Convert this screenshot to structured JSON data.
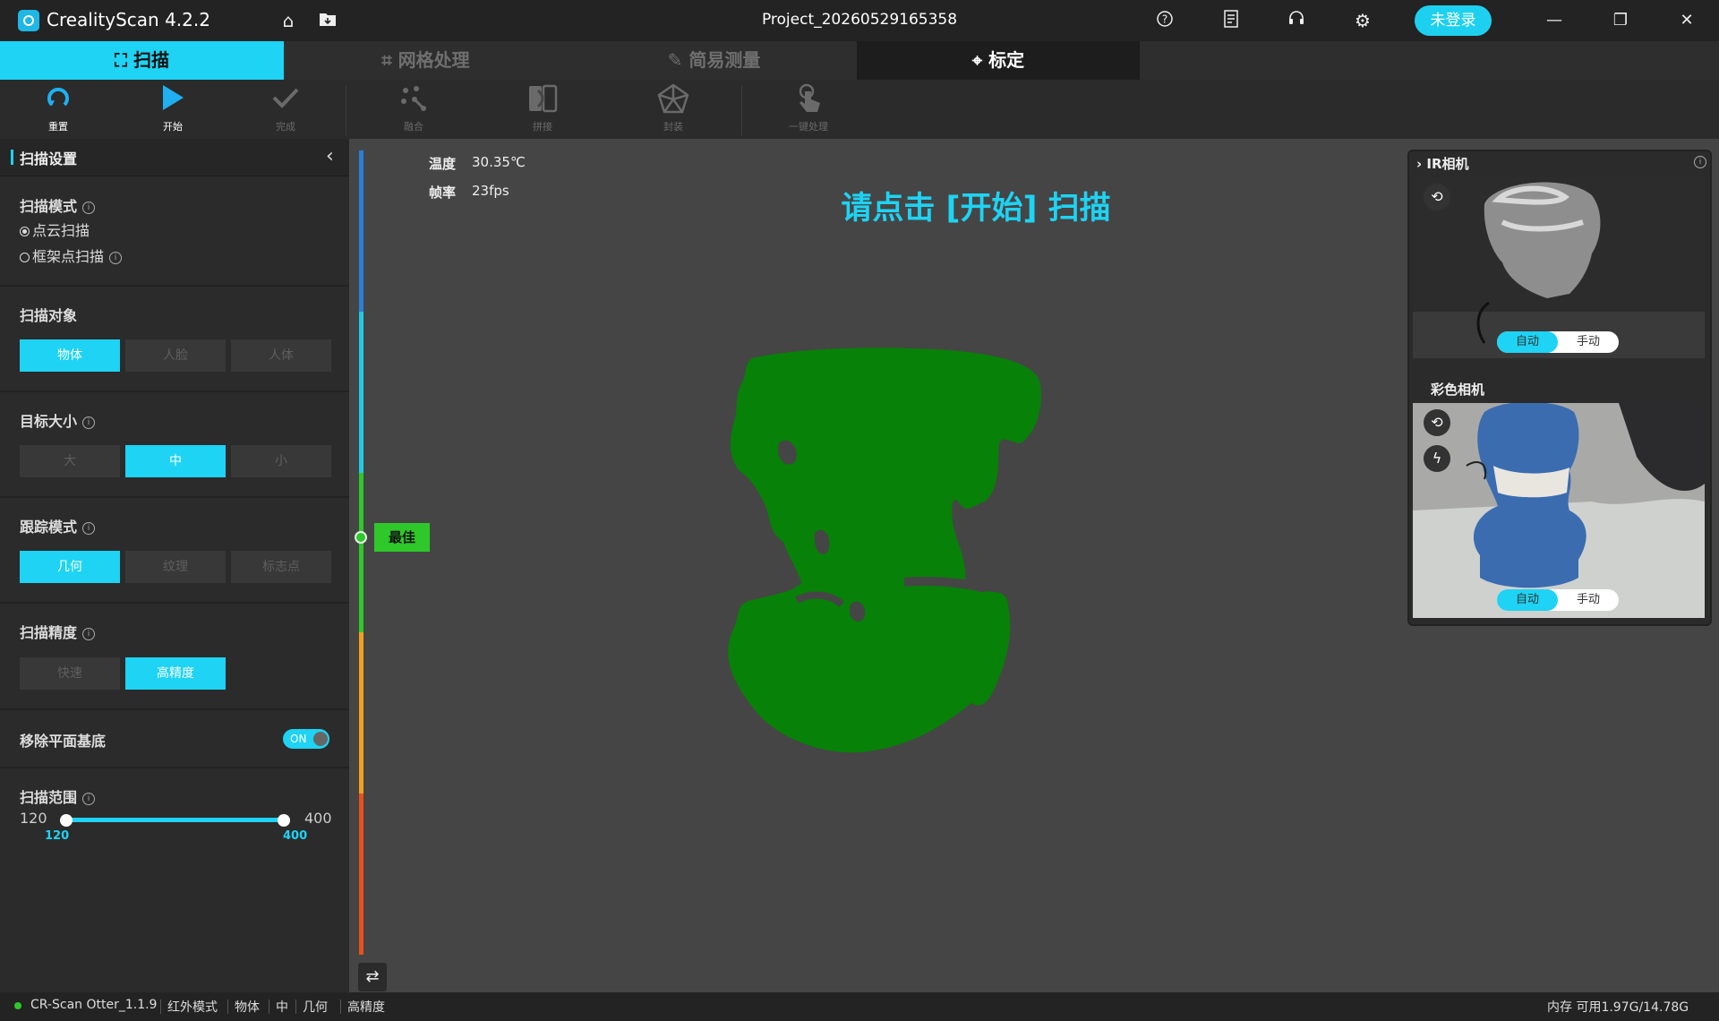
{
  "titlebar": {
    "app_name": "CrealityScan 4.2.2",
    "project": "Project_20260529165358",
    "login": "未登录",
    "icons": [
      "home-icon",
      "folder-icon",
      "help-icon",
      "notes-icon",
      "support-icon",
      "settings-icon"
    ],
    "window_controls": [
      "minimize-icon",
      "restore-icon",
      "close-icon"
    ]
  },
  "tabs": [
    {
      "label": "扫描",
      "icon": "scan-icon",
      "active": true
    },
    {
      "label": "网格处理",
      "icon": "crop-icon",
      "active": false
    },
    {
      "label": "简易测量",
      "icon": "ruler-icon",
      "active": false
    },
    {
      "label": "标定",
      "icon": "crosshair-icon",
      "active": false
    }
  ],
  "toolbar": [
    {
      "label": "重置",
      "icon": "reset-icon",
      "enabled": true
    },
    {
      "label": "开始",
      "icon": "play-icon",
      "enabled": true
    },
    {
      "label": "完成",
      "icon": "check-icon",
      "enabled": false
    },
    {
      "label": "融合",
      "icon": "fuse-icon",
      "enabled": false
    },
    {
      "label": "拼接",
      "icon": "merge-icon",
      "enabled": false
    },
    {
      "label": "封装",
      "icon": "mesh-icon",
      "enabled": false
    },
    {
      "label": "一键处理",
      "icon": "one-click-icon",
      "enabled": false
    }
  ],
  "settings": {
    "header": "扫描设置",
    "scan_mode": {
      "title": "扫描模式",
      "options": [
        "点云扫描",
        "框架点扫描"
      ],
      "selected": "点云扫描"
    },
    "scan_target": {
      "title": "扫描对象",
      "options": [
        "物体",
        "人脸",
        "人体"
      ],
      "selected": "物体"
    },
    "target_size": {
      "title": "目标大小",
      "options": [
        "大",
        "中",
        "小"
      ],
      "selected": "中"
    },
    "tracking_mode": {
      "title": "跟踪模式",
      "options": [
        "几何",
        "纹理",
        "标志点"
      ],
      "selected": "几何"
    },
    "precision": {
      "title": "扫描精度",
      "options": [
        "快速",
        "高精度"
      ],
      "selected": "高精度"
    },
    "remove_plane": {
      "title": "移除平面基底",
      "toggle": "ON",
      "enabled": true
    },
    "scan_range": {
      "title": "扫描范围",
      "min": 120,
      "max": 400,
      "low": 120,
      "high": 400,
      "min_label": "120",
      "max_label": "400",
      "low_label": "120",
      "high_label": "400"
    }
  },
  "viewport": {
    "temp_label": "温度",
    "temp_value": "30.35℃",
    "fps_label": "帧率",
    "fps_value": "23fps",
    "prompt": "请点击 [开始] 扫描",
    "quality_label": "最佳",
    "pointcloud_color": "#078107"
  },
  "cameras": {
    "ir": {
      "title": "IR相机",
      "auto": "自动",
      "manual": "手动",
      "mode": "自动"
    },
    "color": {
      "title": "彩色相机",
      "auto": "自动",
      "manual": "手动",
      "mode": "自动"
    }
  },
  "status": {
    "device": "CR-Scan Otter_1.1.9",
    "items": [
      "红外模式",
      "物体",
      "中",
      "几何",
      "高精度"
    ],
    "memory": "内存 可用1.97G/14.78G"
  },
  "colors": {
    "accent": "#1ed3f3",
    "good": "#2ec82a"
  }
}
